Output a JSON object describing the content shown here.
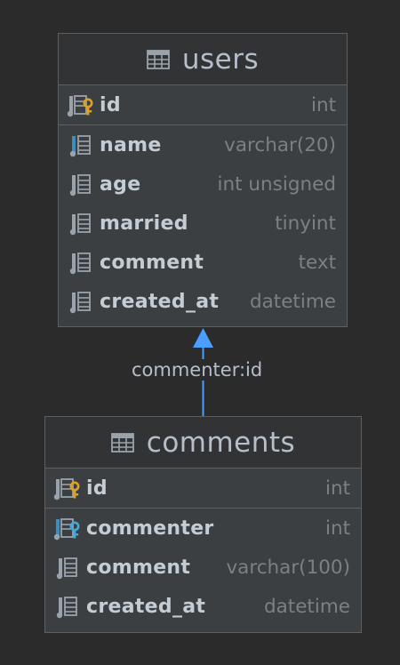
{
  "tables": {
    "users": {
      "name": "users",
      "pk": {
        "name": "id",
        "type": "int",
        "icon": "primary-key-column-icon"
      },
      "columns": [
        {
          "name": "name",
          "type": "varchar(20)",
          "icon": "not-null-column-icon"
        },
        {
          "name": "age",
          "type": "int unsigned",
          "icon": "column-icon"
        },
        {
          "name": "married",
          "type": "tinyint",
          "icon": "column-icon"
        },
        {
          "name": "comment",
          "type": "text",
          "icon": "column-icon"
        },
        {
          "name": "created_at",
          "type": "datetime",
          "icon": "column-icon"
        }
      ]
    },
    "comments": {
      "name": "comments",
      "pk": {
        "name": "id",
        "type": "int",
        "icon": "primary-key-column-icon"
      },
      "columns": [
        {
          "name": "commenter",
          "type": "int",
          "icon": "foreign-key-column-icon"
        },
        {
          "name": "comment",
          "type": "varchar(100)",
          "icon": "column-icon"
        },
        {
          "name": "created_at",
          "type": "datetime",
          "icon": "column-icon"
        }
      ]
    }
  },
  "relation": {
    "label": "commenter:id",
    "from": "comments",
    "to": "users"
  },
  "colors": {
    "background": "#2b2b2b",
    "box": "#3c3f41",
    "header": "#313335",
    "border": "#5d5f61",
    "text": "#c4ccd4",
    "type_text": "#7c8084",
    "arrow": "#4a9eff",
    "pk_key": "#e0a020",
    "fk_key": "#3fa9d9",
    "not_null_bar": "#3d8ebd"
  }
}
